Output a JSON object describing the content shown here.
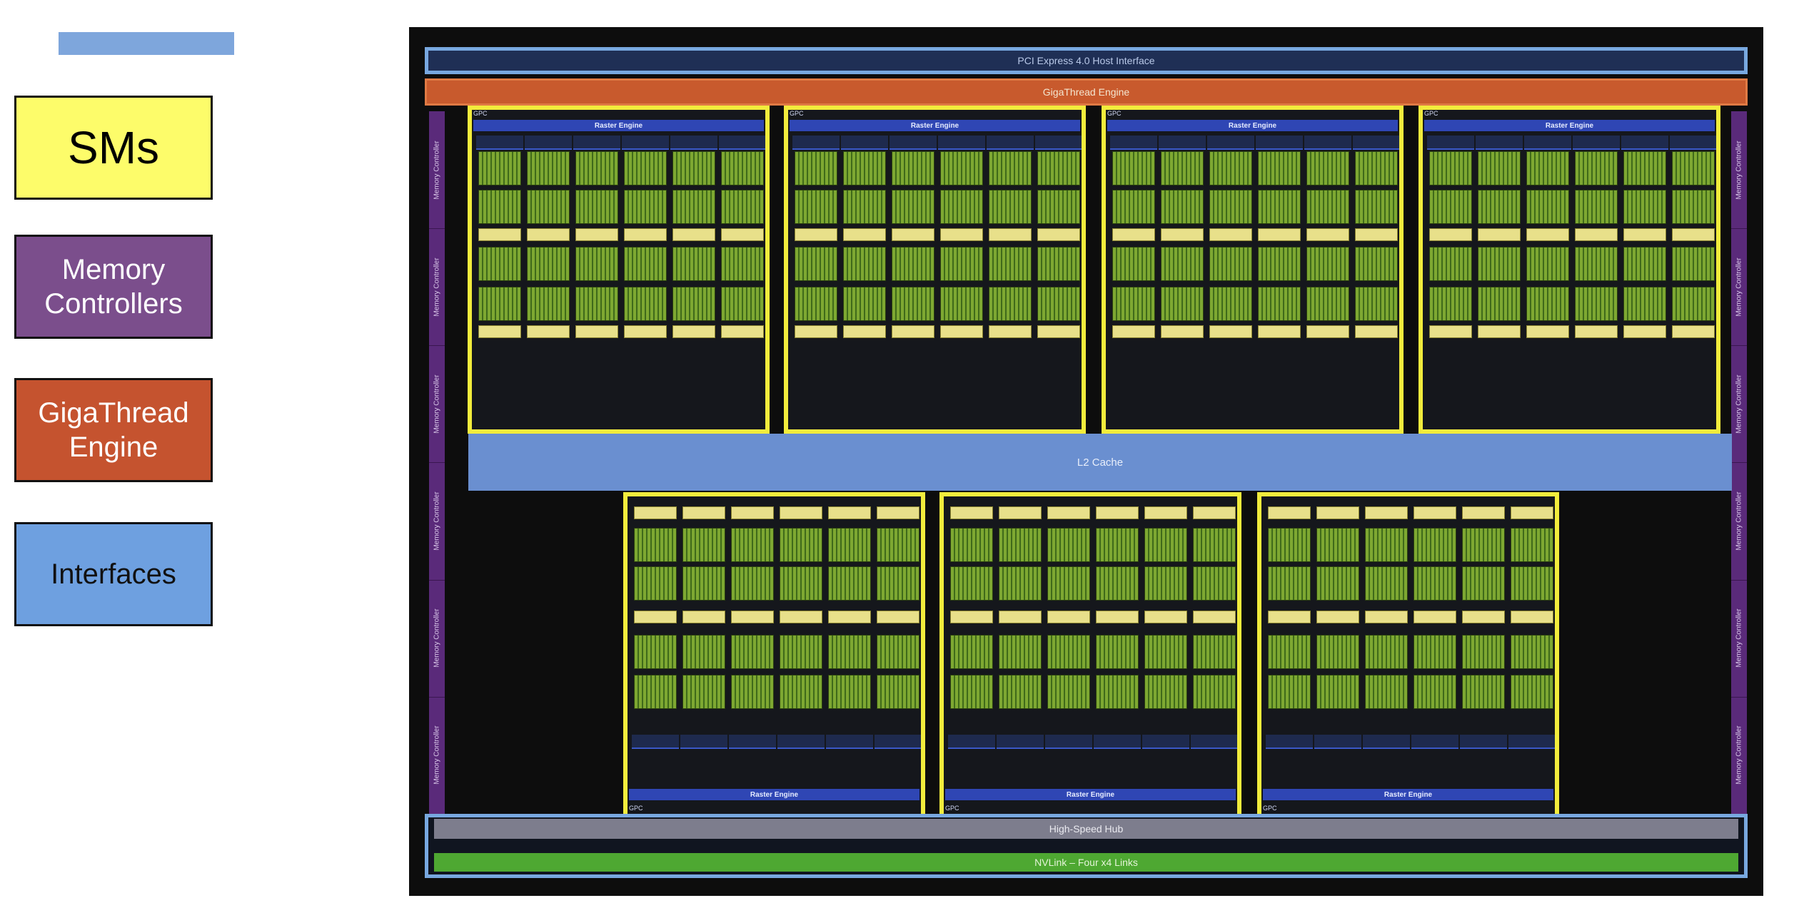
{
  "legend": {
    "items": [
      {
        "id": "sms",
        "label": "SMs",
        "color": "#fdfc6a"
      },
      {
        "id": "mem",
        "label": "Memory\nControllers",
        "color": "#7b4e8c"
      },
      {
        "id": "giga",
        "label": "GigaThread\nEngine",
        "color": "#c5532f"
      },
      {
        "id": "if",
        "label": "Interfaces",
        "color": "#6ea0e0"
      }
    ]
  },
  "die": {
    "pcie_label": "PCI Express 4.0 Host Interface",
    "giga_label": "GigaThread Engine",
    "l2_label": "L2 Cache",
    "hub_label": "High-Speed Hub",
    "nvlink_label": "NVLink – Four x4 Links",
    "memory_controller_label": "Memory Controller",
    "gpc_label": "GPC",
    "raster_label": "Raster Engine",
    "top_gpc_count": 4,
    "bottom_gpc_count": 3,
    "tpcs_per_gpc": 6,
    "left_memory_controllers": 6,
    "right_memory_controllers": 6
  }
}
